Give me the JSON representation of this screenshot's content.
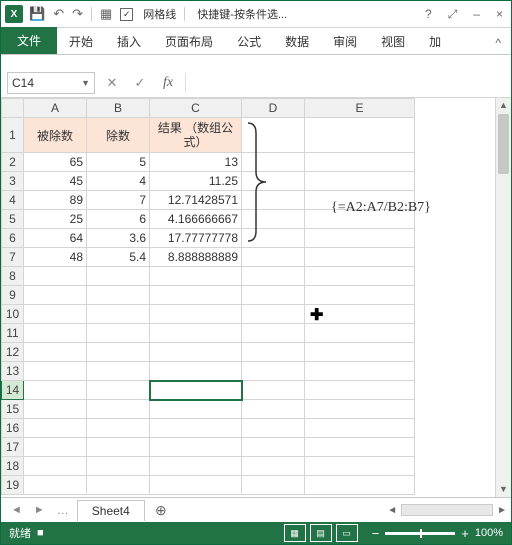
{
  "title": {
    "app": "X",
    "filename": "快捷键-按条件选...",
    "gridlines": "网格线"
  },
  "wincontrols": {
    "help": "?",
    "full": "⤢",
    "min": "–",
    "close": "×"
  },
  "ribbon": {
    "file": "文件",
    "tabs": [
      "开始",
      "插入",
      "页面布局",
      "公式",
      "数据",
      "审阅",
      "视图",
      "加"
    ],
    "collapse": "^"
  },
  "namebox": "C14",
  "columns": [
    "A",
    "B",
    "C",
    "D",
    "E"
  ],
  "header_row": [
    "被除数",
    "除数",
    "结果\n（数组公式）"
  ],
  "rows": [
    {
      "A": "65",
      "B": "5",
      "C": "13"
    },
    {
      "A": "45",
      "B": "4",
      "C": "11.25"
    },
    {
      "A": "89",
      "B": "7",
      "C": "12.71428571"
    },
    {
      "A": "25",
      "B": "6",
      "C": "4.166666667"
    },
    {
      "A": "64",
      "B": "3.6",
      "C": "17.77777778"
    },
    {
      "A": "48",
      "B": "5.4",
      "C": "8.888888889"
    }
  ],
  "annotation": "{=A2:A7/B2:B7}",
  "sheet": {
    "name": "Sheet4"
  },
  "status": {
    "ready": "就绪",
    "zoom": "100%"
  },
  "selected_cell": "C14"
}
